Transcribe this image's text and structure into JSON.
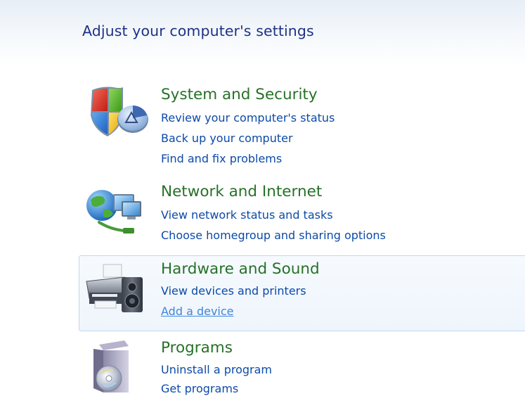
{
  "header": {
    "title": "Adjust your computer's settings"
  },
  "categories": [
    {
      "title": "System and Security",
      "icon": "shield-icon",
      "links": [
        "Review your computer's status",
        "Back up your computer",
        "Find and fix problems"
      ]
    },
    {
      "title": "Network and Internet",
      "icon": "network-globe-icon",
      "links": [
        "View network status and tasks",
        "Choose homegroup and sharing options"
      ]
    },
    {
      "title": "Hardware and Sound",
      "icon": "printer-speaker-icon",
      "links": [
        "View devices and printers",
        "Add a device"
      ],
      "hovered_link": "Add a device"
    },
    {
      "title": "Programs",
      "icon": "program-box-icon",
      "links": [
        "Uninstall a program",
        "Get programs"
      ]
    }
  ],
  "colors": {
    "category_title": "#267128",
    "link": "#0c4aa8",
    "hover_link": "#3f86d9",
    "page_title": "#1e3287",
    "hover_border": "#c5d6ea"
  }
}
